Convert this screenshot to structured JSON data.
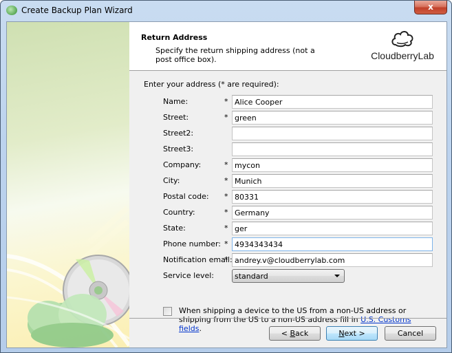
{
  "window": {
    "title": "Create Backup Plan Wizard",
    "close_label": "x",
    "app_icon": "cloudberry-cloud-icon"
  },
  "header": {
    "title": "Return Address",
    "description": "Specify the return shipping address (not a post office box).",
    "logo_text": "CloudberryLab",
    "logo_icon": "cloud-outline-icon"
  },
  "form": {
    "intro": "Enter your address (* are required):",
    "fields": [
      {
        "label": "Name:",
        "required": "*",
        "value": "Alice Cooper"
      },
      {
        "label": "Street:",
        "required": "*",
        "value": "green"
      },
      {
        "label": "Street2:",
        "required": "",
        "value": ""
      },
      {
        "label": "Street3:",
        "required": "",
        "value": ""
      },
      {
        "label": "Company:",
        "required": "*",
        "value": "mycon"
      },
      {
        "label": "City:",
        "required": "*",
        "value": "Munich"
      },
      {
        "label": "Postal code:",
        "required": "*",
        "value": "80331"
      },
      {
        "label": "Country:",
        "required": "*",
        "value": "Germany"
      },
      {
        "label": "State:",
        "required": "*",
        "value": "ger"
      },
      {
        "label": "Phone number:",
        "required": "*",
        "value": "4934343434"
      },
      {
        "label": "Notification email:",
        "required": "*",
        "value": "andrey.v@cloudberrylab.com"
      }
    ],
    "service_level": {
      "label": "Service level:",
      "value": "standard"
    },
    "customs": {
      "checked": false,
      "text": "When shipping a device to the US from a non-US address or shipping from the US to a non-US address fill in ",
      "link": "U.S. Customs fields",
      "suffix": "."
    }
  },
  "buttons": {
    "back_prefix": "< ",
    "back_mnemonic": "B",
    "back_rest": "ack",
    "next_mnemonic": "N",
    "next_rest": "ext >",
    "cancel": "Cancel"
  }
}
